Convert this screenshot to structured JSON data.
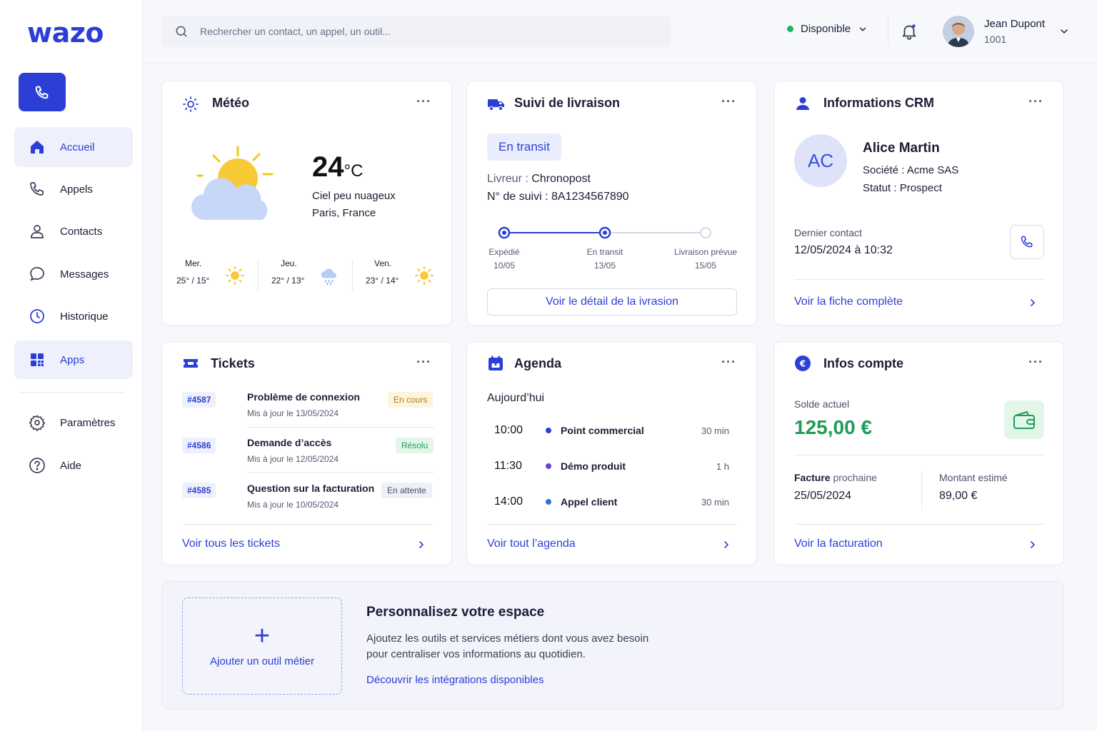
{
  "brand": {
    "logo": "wazo",
    "accent": "#2b3fd6"
  },
  "sidebar": {
    "call_icon": "phone-icon",
    "items": [
      {
        "label": "Accueil",
        "icon": "home-icon",
        "active": true
      },
      {
        "label": "Appels",
        "icon": "phone-icon",
        "active": false
      },
      {
        "label": "Contacts",
        "icon": "user-icon",
        "active": false
      },
      {
        "label": "Messages",
        "icon": "chat-bubble-icon",
        "active": false
      },
      {
        "label": "Historique",
        "icon": "clock-icon",
        "active": false
      },
      {
        "label": "Apps",
        "icon": "apps-grid-icon",
        "active": true
      }
    ],
    "bottom_items": [
      {
        "label": "Paramètres",
        "icon": "gear-icon"
      },
      {
        "label": "Aide",
        "icon": "help-icon"
      }
    ]
  },
  "header": {
    "search_placeholder": "Rechercher un contact, un appel, un outil...",
    "status": "Disponible",
    "status_color": "#22b45d",
    "user": {
      "name": "Jean Dupont",
      "extension": "1001"
    }
  },
  "weather": {
    "title": "Météo",
    "temperature": "24",
    "unit": "°C",
    "condition": "Ciel peu nuageux",
    "location": "Paris, France",
    "forecast": [
      {
        "day": "Mer.",
        "temps": "25° / 15°",
        "icon": "sun-icon"
      },
      {
        "day": "Jeu.",
        "temps": "22° / 13°",
        "icon": "rain-cloud-icon"
      },
      {
        "day": "Ven.",
        "temps": "23° / 14°",
        "icon": "sun-icon"
      }
    ]
  },
  "delivery": {
    "title": "Suivi de livraison",
    "status": "En transit",
    "carrier_label": "Livreur :",
    "carrier": "Chronopost",
    "tracking_label": "N° de suivi :",
    "tracking": "8A1234567890",
    "steps": [
      {
        "label": "Expédié",
        "date": "10/05",
        "done": true
      },
      {
        "label": "En transit",
        "date": "13/05",
        "done": true
      },
      {
        "label": "Livraison prévue",
        "date": "15/05",
        "done": false
      }
    ],
    "button": "Voir le détail de la ivrasion"
  },
  "crm": {
    "title": "Informations CRM",
    "initials": "AC",
    "name": "Alice Martin",
    "company_label": "Société :",
    "company": "Acme SAS",
    "status_label": "Statut :",
    "status": "Prospect",
    "last_contact_label": "Dernier contact",
    "last_contact": "12/05/2024 à 10:32",
    "link": "Voir la fiche complète"
  },
  "tickets": {
    "title": "Tickets",
    "items": [
      {
        "id": "#4587",
        "title": "Problème de connexion",
        "updated": "Mis à jour le 13/05/2024",
        "status": "En cours"
      },
      {
        "id": "#4586",
        "title": "Demande d’accès",
        "updated": "Mis à jour le 12/05/2024",
        "status": "Résolu"
      },
      {
        "id": "#4585",
        "title": "Question sur la facturation",
        "updated": "Mis à jour le 10/05/2024",
        "status": "En attente"
      }
    ],
    "link": "Voir tous les tickets"
  },
  "agenda": {
    "title": "Agenda",
    "day": "Aujourd’hui",
    "events": [
      {
        "time": "10:00",
        "title": "Point commercial",
        "duration": "30 min",
        "color": "#2b3fd6"
      },
      {
        "time": "11:30",
        "title": "Démo produit",
        "duration": "1 h",
        "color": "#6b3fd6"
      },
      {
        "time": "14:00",
        "title": "Appel client",
        "duration": "30 min",
        "color": "#2b6fe6"
      }
    ],
    "link": "Voir tout l’agenda"
  },
  "account": {
    "title": "Infos compte",
    "balance_label": "Solde actuel",
    "balance": "125,00 €",
    "next_invoice_label_bold": "Facture",
    "next_invoice_label_rest": " prochaine",
    "next_invoice_date": "25/05/2024",
    "estimate_label": "Montant estimé",
    "estimate": "89,00 €",
    "link": "Voir la facturation"
  },
  "banner": {
    "add_label": "Ajouter un outil métier",
    "title": "Personnalisez votre espace",
    "text_line1": "Ajoutez les outils et services métiers dont vous avez besoin",
    "text_line2": "pour centraliser vos informations au quotidien.",
    "link": "Découvrir les intégrations disponibles"
  }
}
